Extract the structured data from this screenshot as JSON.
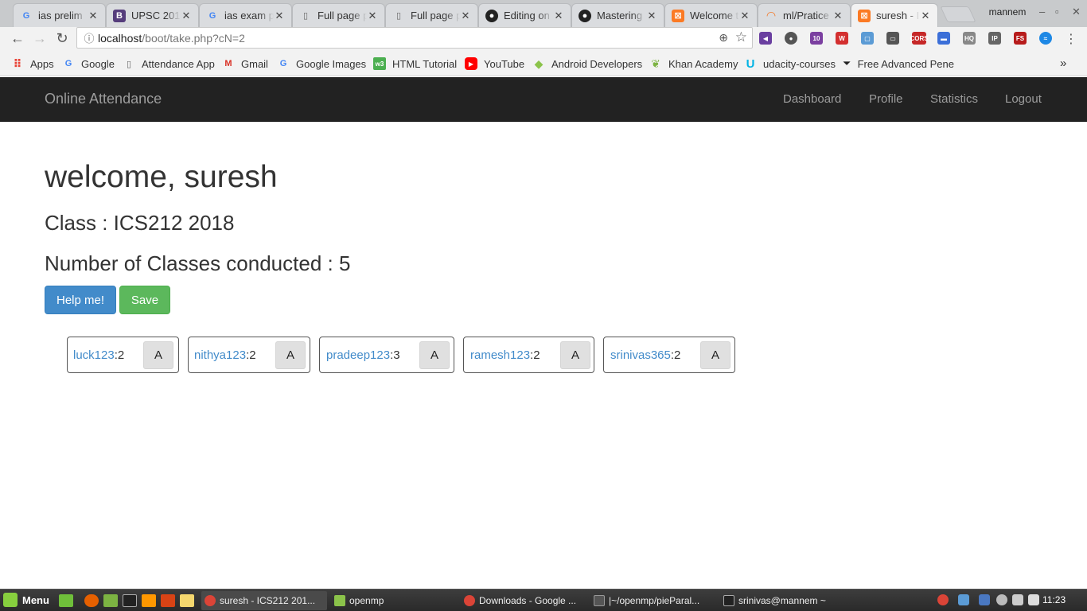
{
  "browser": {
    "tabs": [
      {
        "title": "ias prelim",
        "icon": "google-icon",
        "color": "#4285f4"
      },
      {
        "title": "UPSC 201",
        "icon": "bootstrap-icon",
        "color": "#563d7c"
      },
      {
        "title": "ias exam p",
        "icon": "google-icon",
        "color": "#4285f4"
      },
      {
        "title": "Full page p",
        "icon": "page-icon",
        "color": "#666666"
      },
      {
        "title": "Full page p",
        "icon": "page-icon",
        "color": "#666666"
      },
      {
        "title": "Editing on",
        "icon": "github-icon",
        "color": "#222222"
      },
      {
        "title": "Mastering",
        "icon": "github-icon",
        "color": "#222222"
      },
      {
        "title": "Welcome t",
        "icon": "xampp-icon",
        "color": "#fb7a24"
      },
      {
        "title": "ml/Pratice",
        "icon": "jupyter-icon",
        "color": "#f37726"
      },
      {
        "title": "suresh - IC",
        "icon": "xampp-icon",
        "color": "#fb7a24"
      }
    ],
    "profile": "mannem",
    "url_host": "localhost",
    "url_path": "/boot/take.php?cN=2",
    "bookmarks": [
      {
        "label": "Apps",
        "icon": "apps-grid-icon"
      },
      {
        "label": "Google",
        "icon": "google-icon"
      },
      {
        "label": "Attendance App",
        "icon": "page-icon"
      },
      {
        "label": "Gmail",
        "icon": "gmail-icon"
      },
      {
        "label": "Google Images",
        "icon": "google-icon"
      },
      {
        "label": "HTML Tutorial",
        "icon": "w3schools-icon"
      },
      {
        "label": "YouTube",
        "icon": "youtube-icon"
      },
      {
        "label": "Android Developers",
        "icon": "android-icon"
      },
      {
        "label": "Khan Academy",
        "icon": "khan-academy-icon"
      },
      {
        "label": "udacity-courses",
        "icon": "udacity-icon"
      },
      {
        "label": "Free Advanced Pene",
        "icon": "offsec-icon"
      }
    ]
  },
  "navbar": {
    "brand": "Online Attendance",
    "links": [
      "Dashboard",
      "Profile",
      "Statistics",
      "Logout"
    ]
  },
  "main": {
    "welcome": "welcome, suresh",
    "class_line": "Class : ICS212 2018",
    "classes_line": "Number of Classes conducted : 5",
    "help_button": "Help me!",
    "save_button": "Save",
    "students": [
      {
        "name": "luck123",
        "count": ":2",
        "status": "A"
      },
      {
        "name": "nithya123",
        "count": ":2",
        "status": "A"
      },
      {
        "name": "pradeep123",
        "count": ":3",
        "status": "A"
      },
      {
        "name": "ramesh123",
        "count": ":2",
        "status": "A"
      },
      {
        "name": "srinivas365",
        "count": ":2",
        "status": "A"
      }
    ]
  },
  "taskbar": {
    "menu_label": "Menu",
    "tasks": [
      "suresh - ICS212 201...",
      "openmp",
      "Downloads - Google ...",
      "|~/openmp/pieParal...",
      "srinivas@mannem ~"
    ],
    "clock": "11:23"
  },
  "colors": {
    "navbar_bg": "#222222",
    "primary": "#428bca",
    "success": "#5cb85c",
    "link": "#428bca"
  }
}
